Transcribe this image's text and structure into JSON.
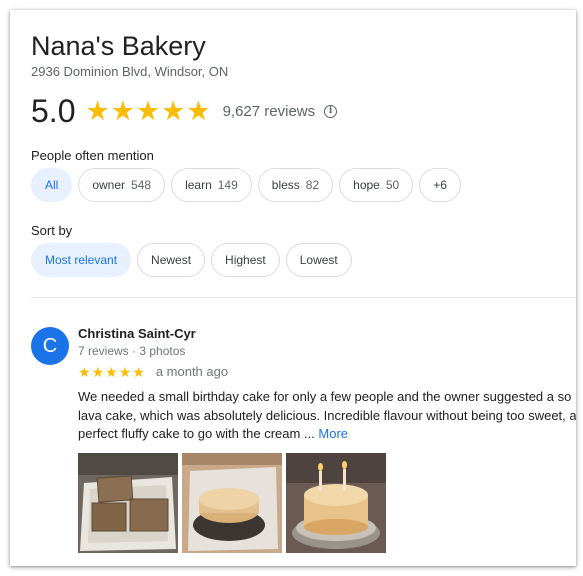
{
  "place": {
    "name": "Nana's Bakery",
    "address": "2936 Dominion Blvd, Windsor, ON",
    "rating": "5.0",
    "review_count": "9,627 reviews",
    "star_color": "#fbbc04"
  },
  "mentions": {
    "label": "People often mention",
    "chips": [
      {
        "label": "All",
        "count": ""
      },
      {
        "label": "owner",
        "count": "548"
      },
      {
        "label": "learn",
        "count": "149"
      },
      {
        "label": "bless",
        "count": "82"
      },
      {
        "label": "hope",
        "count": "50"
      },
      {
        "label": "+6",
        "count": ""
      }
    ]
  },
  "sort": {
    "label": "Sort by",
    "options": [
      "Most relevant",
      "Newest",
      "Highest",
      "Lowest"
    ]
  },
  "review": {
    "avatar_letter": "C",
    "avatar_color": "#1a73e8",
    "author": "Christina Saint-Cyr",
    "meta": "7 reviews · 3 photos",
    "stars": 5,
    "date": "a month ago",
    "text_lines": [
      "We needed a small birthday cake for only a few people and the owner suggested a so",
      "lava cake, which was absolutely delicious. Incredible flavour without being too sweet, a",
      "perfect fluffy cake to go with the cream"
    ],
    "ellipsis": "...",
    "more_label": "More"
  }
}
